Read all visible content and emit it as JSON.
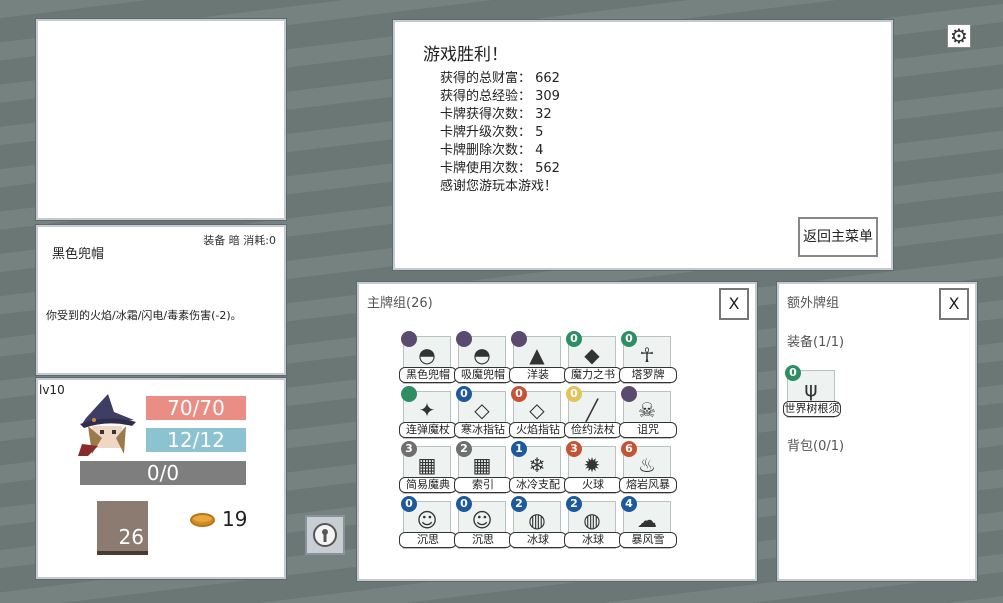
{
  "player": {
    "level": "lv10",
    "hp": "70/70",
    "mp": "12/12",
    "xp": "0/0",
    "deck_count": "26",
    "gold": "19"
  },
  "card_info": {
    "title": "黑色兜帽",
    "meta": "装备 暗 消耗:0",
    "description": "你受到的火焰/冰霜/闪电/毒素伤害(-2)。"
  },
  "victory": {
    "title": "游戏胜利！",
    "stats": [
      "获得的总财富： 662",
      "获得的总经验： 309",
      "卡牌获得次数： 32",
      "卡牌升级次数： 5",
      "卡牌删除次数： 4",
      "卡牌使用次数： 562",
      "感谢您游玩本游戏！"
    ],
    "back_button": "返回主菜单"
  },
  "main_deck": {
    "title": "主牌组(26)",
    "close": "X",
    "cards": [
      {
        "name": "黑色兜帽",
        "cost": "",
        "color": "purple",
        "icon": "hood-icon",
        "sym": "◓"
      },
      {
        "name": "吸魔兜帽",
        "cost": "",
        "color": "purple",
        "icon": "hood-icon",
        "sym": "◓"
      },
      {
        "name": "洋装",
        "cost": "",
        "color": "purple",
        "icon": "dress-icon",
        "sym": "▲"
      },
      {
        "name": "魔力之书",
        "cost": "0",
        "color": "green",
        "icon": "book-icon",
        "sym": "◆"
      },
      {
        "name": "塔罗牌",
        "cost": "0",
        "color": "green",
        "icon": "tarot-icon",
        "sym": "☥"
      },
      {
        "name": "连弹魔杖",
        "cost": "",
        "color": "green",
        "icon": "wand-icon",
        "sym": "✦"
      },
      {
        "name": "寒冰指钻",
        "cost": "0",
        "color": "blue",
        "icon": "ring-icon",
        "sym": "◇"
      },
      {
        "name": "火焰指钻",
        "cost": "0",
        "color": "red",
        "icon": "ring-icon",
        "sym": "◇"
      },
      {
        "name": "俭约法杖",
        "cost": "0",
        "color": "yellow",
        "icon": "staff-icon",
        "sym": "╱"
      },
      {
        "name": "诅咒",
        "cost": "",
        "color": "purple",
        "icon": "curse-icon",
        "sym": "☠"
      },
      {
        "name": "简易魔典",
        "cost": "3",
        "color": "gray",
        "icon": "tome-icon",
        "sym": "▦"
      },
      {
        "name": "索引",
        "cost": "2",
        "color": "gray",
        "icon": "index-icon",
        "sym": "▦"
      },
      {
        "name": "冰冷支配",
        "cost": "1",
        "color": "blue",
        "icon": "snowflake-icon",
        "sym": "❄"
      },
      {
        "name": "火球",
        "cost": "3",
        "color": "red",
        "icon": "fireball-icon",
        "sym": "✹"
      },
      {
        "name": "熔岩风暴",
        "cost": "6",
        "color": "red",
        "icon": "lava-icon",
        "sym": "♨"
      },
      {
        "name": "沉思",
        "cost": "0",
        "color": "blue",
        "icon": "thinking-icon",
        "sym": "☺"
      },
      {
        "name": "沉思",
        "cost": "0",
        "color": "blue",
        "icon": "thinking-icon",
        "sym": "☺"
      },
      {
        "name": "冰球",
        "cost": "2",
        "color": "blue",
        "icon": "iceball-icon",
        "sym": "◍"
      },
      {
        "name": "冰球",
        "cost": "2",
        "color": "blue",
        "icon": "iceball-icon",
        "sym": "◍"
      },
      {
        "name": "暴风雪",
        "cost": "4",
        "color": "blue",
        "icon": "blizzard-icon",
        "sym": "☁"
      }
    ]
  },
  "extra_deck": {
    "title": "额外牌组",
    "close": "X",
    "equip_label": "装备(1/1)",
    "bag_label": "背包(0/1)",
    "equip_cards": [
      {
        "name": "世界树根须",
        "cost": "0",
        "color": "green",
        "icon": "roots-icon",
        "sym": "ψ"
      }
    ]
  },
  "colors": {
    "purple": "#5a4a70",
    "blue": "#1d5a9c",
    "red": "#c55437",
    "yellow": "#e2c35c",
    "green": "#2d8d63",
    "gray": "#6f6f6f"
  }
}
